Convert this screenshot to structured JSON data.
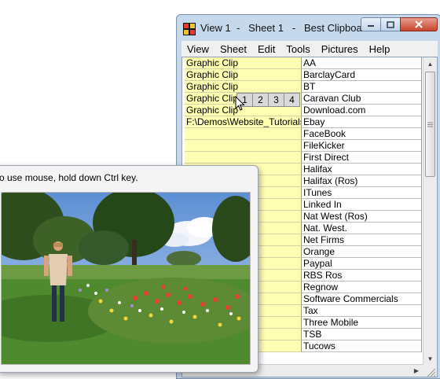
{
  "window": {
    "title": "View 1  -   Sheet 1   -   Best Clipboa...",
    "menu": [
      "View",
      "Sheet",
      "Edit",
      "Tools",
      "Pictures",
      "Help"
    ]
  },
  "grid": {
    "rows": [
      [
        "Graphic Clip",
        "AA"
      ],
      [
        "Graphic Clip",
        "BarclayCard"
      ],
      [
        "Graphic Clip",
        "BT"
      ],
      [
        "Graphic Clip",
        "Caravan Club"
      ],
      [
        "Graphic Clip",
        "Download.com"
      ],
      [
        "F:\\Demos\\Website_Tutorials\\",
        "Ebay"
      ],
      [
        "",
        "FaceBook"
      ],
      [
        "",
        "FileKicker"
      ],
      [
        "",
        "First Direct"
      ],
      [
        "",
        "Halifax"
      ],
      [
        "",
        "Halifax (Ros)"
      ],
      [
        "",
        "ITunes"
      ],
      [
        "",
        "Linked In"
      ],
      [
        "",
        "Nat West (Ros)"
      ],
      [
        "",
        "Nat. West."
      ],
      [
        "",
        "Net Firms"
      ],
      [
        "",
        "Orange"
      ],
      [
        "",
        "Paypal"
      ],
      [
        "",
        "RBS Ros"
      ],
      [
        "",
        "Regnow"
      ],
      [
        "",
        "Software Commercials"
      ],
      [
        "",
        "Tax"
      ],
      [
        "",
        "Three Mobile"
      ],
      [
        "",
        "TSB"
      ],
      [
        "",
        "Tucows"
      ]
    ]
  },
  "picture_tabs": [
    "1",
    "2",
    "3",
    "4"
  ],
  "popup": {
    "tip": "o use mouse, hold down Ctrl key."
  },
  "colors": {
    "clip_column": "#ffffb4",
    "title_bar": "#c6d8ec",
    "close_button": "#c7432e"
  }
}
